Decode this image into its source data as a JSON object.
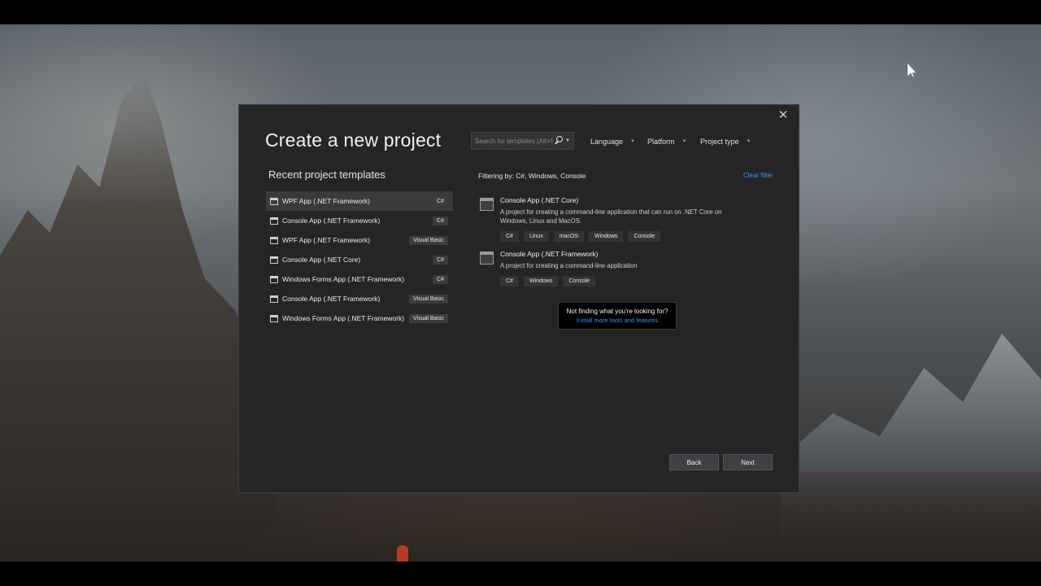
{
  "dialog": {
    "title": "Create a new project",
    "close_glyph": "✕",
    "search": {
      "placeholder": "Search for templates (Alt+S)"
    },
    "filters": {
      "language": "Language",
      "platform": "Platform",
      "project_type": "Project type"
    },
    "recent": {
      "heading": "Recent project templates",
      "items": [
        {
          "name": "WPF App (.NET Framework)",
          "lang": "C#"
        },
        {
          "name": "Console App (.NET Framework)",
          "lang": "C#"
        },
        {
          "name": "WPF App (.NET Framework)",
          "lang": "Visual Basic"
        },
        {
          "name": "Console App (.NET Core)",
          "lang": "C#"
        },
        {
          "name": "Windows Forms App (.NET Framework)",
          "lang": "C#"
        },
        {
          "name": "Console App (.NET Framework)",
          "lang": "Visual Basic"
        },
        {
          "name": "Windows Forms App (.NET Framework)",
          "lang": "Visual Basic"
        }
      ]
    },
    "filtering_text": "Filtering by: C#, Windows, Console",
    "clear_filter": "Clear filter",
    "results": [
      {
        "title": "Console App (.NET Core)",
        "description": "A project for creating a command-line application that can run on .NET Core on Windows, Linux and MacOS.",
        "tags": [
          "C#",
          "Linux",
          "macOS",
          "Windows",
          "Console"
        ]
      },
      {
        "title": "Console App (.NET Framework)",
        "description": "A project for creating a command-line application",
        "tags": [
          "C#",
          "Windows",
          "Console"
        ]
      }
    ],
    "tooltip": {
      "text": "Not finding what you're looking for?",
      "link": "Install more tools and features"
    },
    "buttons": {
      "back": "Back",
      "next": "Next"
    }
  },
  "colors": {
    "dialog_bg": "#252526",
    "accent_link": "#3794ff",
    "selected_row": "#3a3a3d"
  }
}
